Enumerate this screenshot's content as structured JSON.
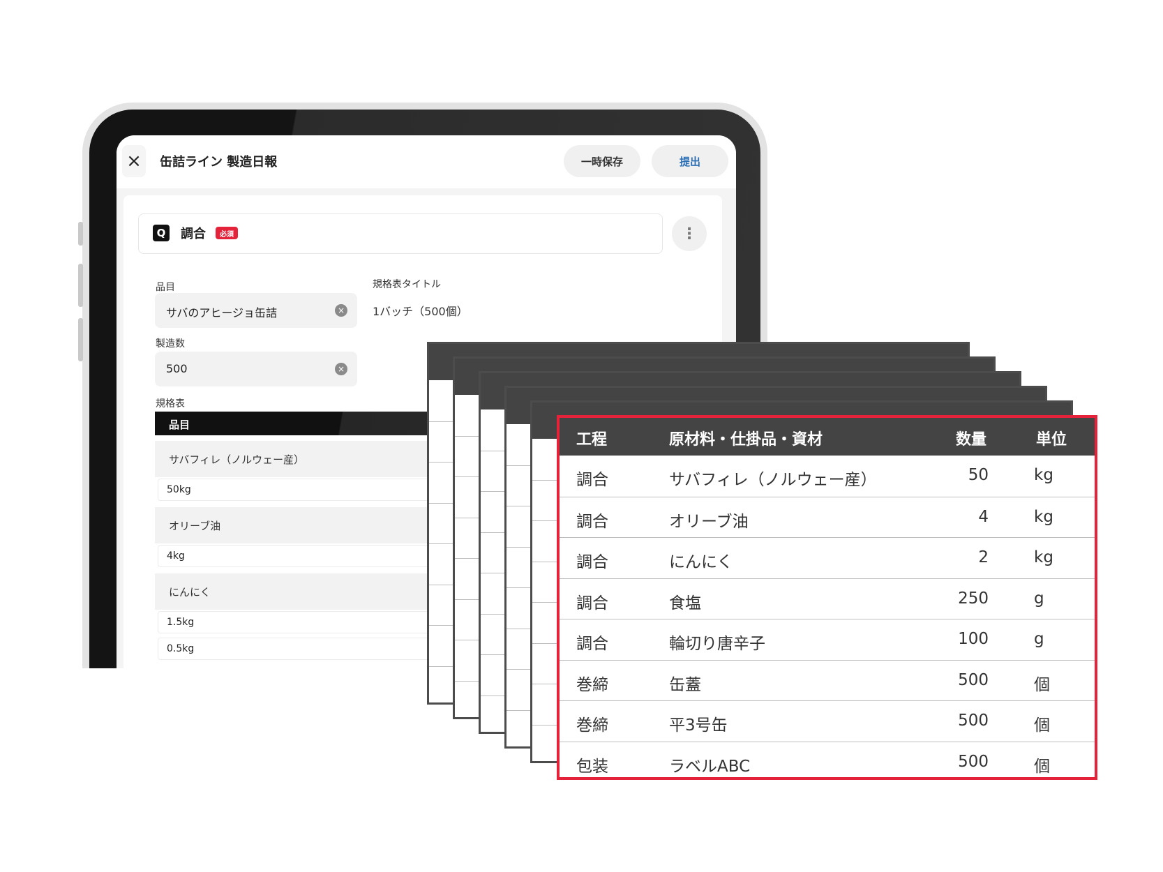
{
  "app": {
    "title": "缶詰ライン 製造日報",
    "close_icon": "×",
    "save_label": "一時保存",
    "submit_label": "提出"
  },
  "section": {
    "icon_label": "Q",
    "name": "調合",
    "required_badge": "必須",
    "menu_icon": "⋮"
  },
  "form": {
    "item_label": "品目",
    "item_value": "サバのアヒージョ缶詰",
    "spec_title_label": "規格表タイトル",
    "spec_title_value": "1バッチ（500個）",
    "quantity_label": "製造数",
    "quantity_value": "500",
    "clear_icon": "×",
    "spec_table_label": "規格表",
    "spec_column_label": "品目"
  },
  "spec_items": [
    {
      "name": "サバフィレ（ノルウェー産）",
      "qty": [
        "50kg"
      ]
    },
    {
      "name": "オリーブ油",
      "qty": [
        "4kg"
      ]
    },
    {
      "name": "にんにく",
      "qty": [
        "1.5kg",
        "0.5kg"
      ]
    }
  ],
  "table": {
    "headers": {
      "step": "工程",
      "material": "原材料・仕掛品・資材",
      "qty": "数量",
      "unit": "単位"
    },
    "rows": [
      {
        "step": "調合",
        "material": "サバフィレ（ノルウェー産）",
        "qty": "50",
        "unit": "kg"
      },
      {
        "step": "調合",
        "material": "オリーブ油",
        "qty": "4",
        "unit": "kg"
      },
      {
        "step": "調合",
        "material": "にんにく",
        "qty": "2",
        "unit": "kg"
      },
      {
        "step": "調合",
        "material": "食塩",
        "qty": "250",
        "unit": "g"
      },
      {
        "step": "調合",
        "material": "輪切り唐辛子",
        "qty": "100",
        "unit": "g"
      },
      {
        "step": "巻締",
        "material": "缶蓋",
        "qty": "500",
        "unit": "個"
      },
      {
        "step": "巻締",
        "material": "平3号缶",
        "qty": "500",
        "unit": "個"
      },
      {
        "step": "包装",
        "material": "ラベルABC",
        "qty": "500",
        "unit": "個"
      }
    ]
  },
  "colors": {
    "accent_red": "#e4233b",
    "submit_blue": "#2c6fb5",
    "table_header": "#444444"
  }
}
